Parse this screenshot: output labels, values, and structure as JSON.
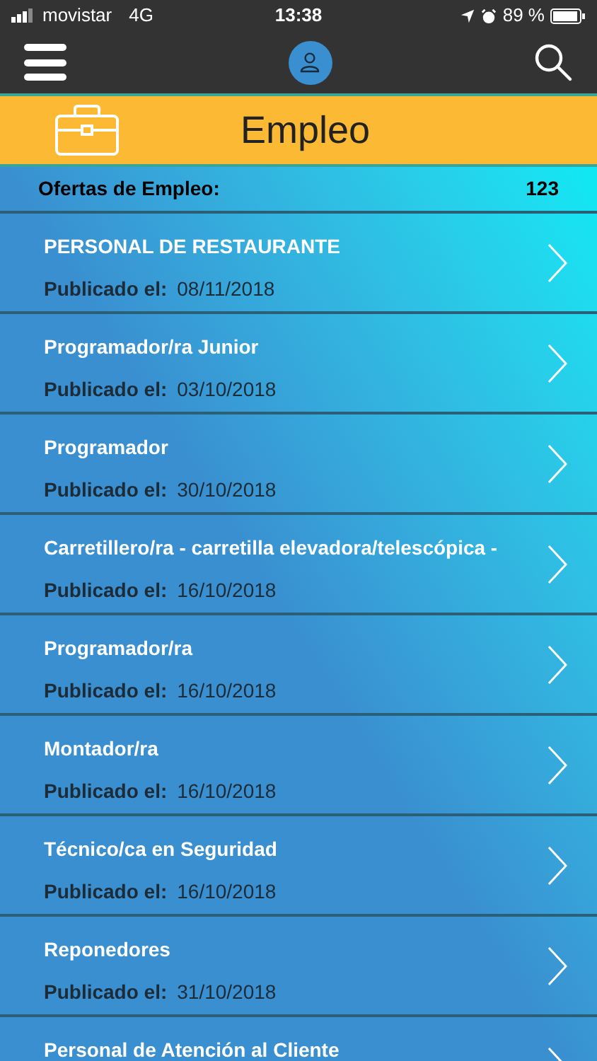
{
  "status_bar": {
    "carrier": "movistar",
    "network": "4G",
    "time": "13:38",
    "battery": "89 %"
  },
  "banner": {
    "title": "Empleo"
  },
  "summary": {
    "label": "Ofertas de Empleo:",
    "count": "123"
  },
  "offers": [
    {
      "title": "PERSONAL DE RESTAURANTE",
      "date_label": "Publicado el:",
      "date": "08/11/2018"
    },
    {
      "title": "Programador/ra Junior",
      "date_label": "Publicado el:",
      "date": "03/10/2018"
    },
    {
      "title": "Programador",
      "date_label": "Publicado el:",
      "date": "30/10/2018"
    },
    {
      "title": "Carretillero/ra - carretilla elevadora/telescópica -",
      "date_label": "Publicado el:",
      "date": "16/10/2018"
    },
    {
      "title": "Programador/ra",
      "date_label": "Publicado el:",
      "date": "16/10/2018"
    },
    {
      "title": "Montador/ra",
      "date_label": "Publicado el:",
      "date": "16/10/2018"
    },
    {
      "title": "Técnico/ca en Seguridad",
      "date_label": "Publicado el:",
      "date": "16/10/2018"
    },
    {
      "title": "Reponedores",
      "date_label": "Publicado el:",
      "date": "31/10/2018"
    },
    {
      "title": "Personal de Atención al Cliente"
    }
  ]
}
